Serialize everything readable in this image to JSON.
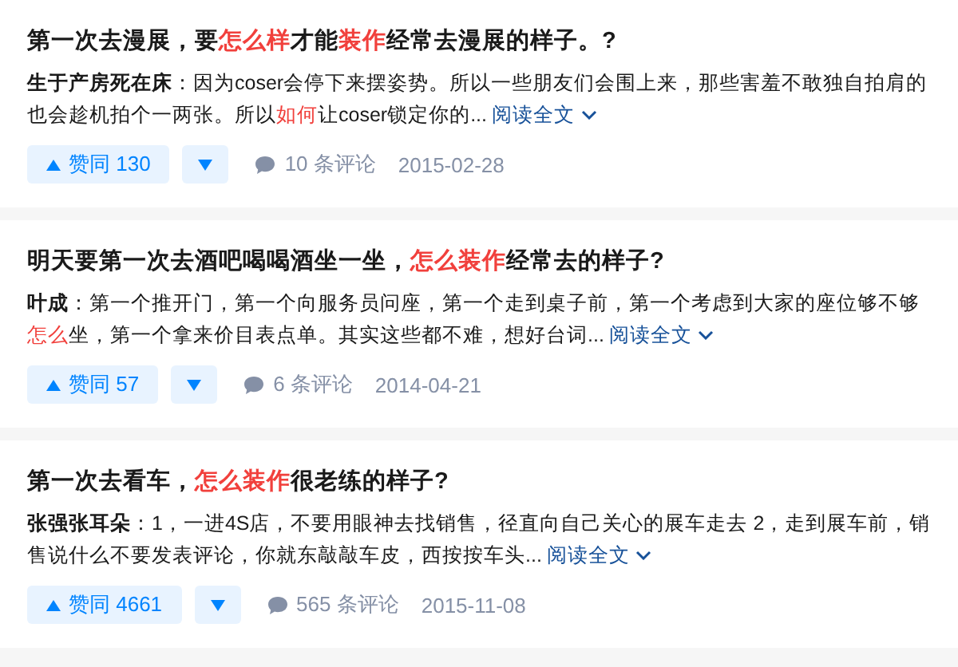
{
  "answers": [
    {
      "title": [
        {
          "text": "第一次去漫展，要",
          "highlight": false
        },
        {
          "text": "怎么样",
          "highlight": true
        },
        {
          "text": "才能",
          "highlight": false
        },
        {
          "text": "装作",
          "highlight": true
        },
        {
          "text": "经常去漫展的样子。?",
          "highlight": false
        }
      ],
      "author": "生于产房死在床",
      "excerpt": [
        {
          "text": "：因为coser会停下来摆姿势。所以一些朋友们会围上来，那些害羞不敢独自拍肩的也会趁机拍个一两张。所以",
          "highlight": false
        },
        {
          "text": "如何",
          "highlight": true
        },
        {
          "text": "让coser锁定你的...",
          "highlight": false
        }
      ],
      "read_more": "阅读全文",
      "votes": "赞同 130",
      "comments": "10 条评论",
      "date": "2015-02-28"
    },
    {
      "title": [
        {
          "text": "明天要第一次去酒吧喝喝酒坐一坐，",
          "highlight": false
        },
        {
          "text": "怎么装作",
          "highlight": true
        },
        {
          "text": "经常去的样子?",
          "highlight": false
        }
      ],
      "author": "叶成",
      "excerpt": [
        {
          "text": "：第一个推开门，第一个向服务员问座，第一个走到桌子前，第一个考虑到大家的座位够不够",
          "highlight": false
        },
        {
          "text": "怎么",
          "highlight": true
        },
        {
          "text": "坐，第一个拿来价目表点单。其实这些都不难，想好台词...",
          "highlight": false
        }
      ],
      "read_more": "阅读全文",
      "votes": "赞同 57",
      "comments": "6 条评论",
      "date": "2014-04-21"
    },
    {
      "title": [
        {
          "text": "第一次去看车，",
          "highlight": false
        },
        {
          "text": "怎么装作",
          "highlight": true
        },
        {
          "text": "很老练的样子?",
          "highlight": false
        }
      ],
      "author": "张强张耳朵",
      "excerpt": [
        {
          "text": "：1，一进4S店，不要用眼神去找销售，径直向自己关心的展车走去 2，走到展车前，销售说什么不要发表评论，你就东敲敲车皮，西按按车头...",
          "highlight": false
        }
      ],
      "read_more": "阅读全文",
      "votes": "赞同 4661",
      "comments": "565 条评论",
      "date": "2015-11-08"
    }
  ]
}
